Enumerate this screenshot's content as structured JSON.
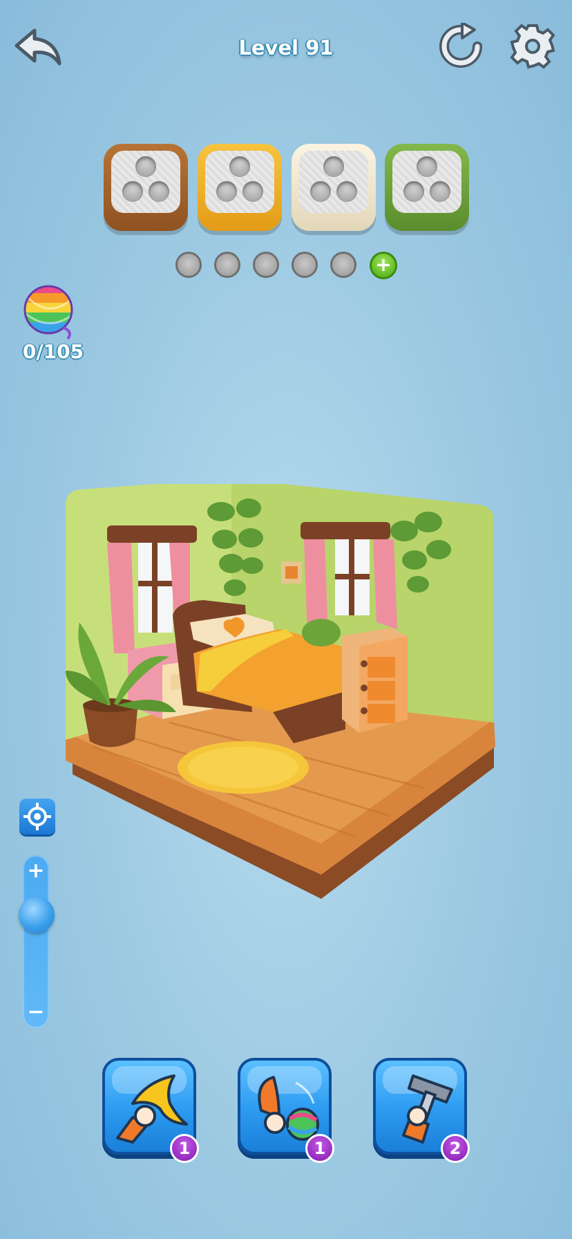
{
  "header": {
    "level_label": "Level 91",
    "back_icon": "back-arrow-icon",
    "restart_icon": "restart-icon",
    "settings_icon": "gear-icon"
  },
  "spools": [
    {
      "name": "brown-spool",
      "color": "#a4622a"
    },
    {
      "name": "yellow-spool",
      "color": "#f2b32a"
    },
    {
      "name": "cream-spool",
      "color": "#efe6cf"
    },
    {
      "name": "green-spool",
      "color": "#6da43a"
    }
  ],
  "slots": {
    "count": 5,
    "add_label": "+"
  },
  "yarn_counter": {
    "icon": "rainbow-yarn-ball-icon",
    "progress_text": "0/105"
  },
  "zoom": {
    "plus_label": "+",
    "minus_label": "−",
    "recenter_icon": "crosshair-icon"
  },
  "boosters": [
    {
      "name": "boomerang-booster",
      "icon": "boomerang-icon",
      "count": "1"
    },
    {
      "name": "throw-yarn-booster",
      "icon": "throw-yarn-icon",
      "count": "1"
    },
    {
      "name": "hammer-booster",
      "icon": "hammer-icon",
      "count": "2"
    }
  ]
}
